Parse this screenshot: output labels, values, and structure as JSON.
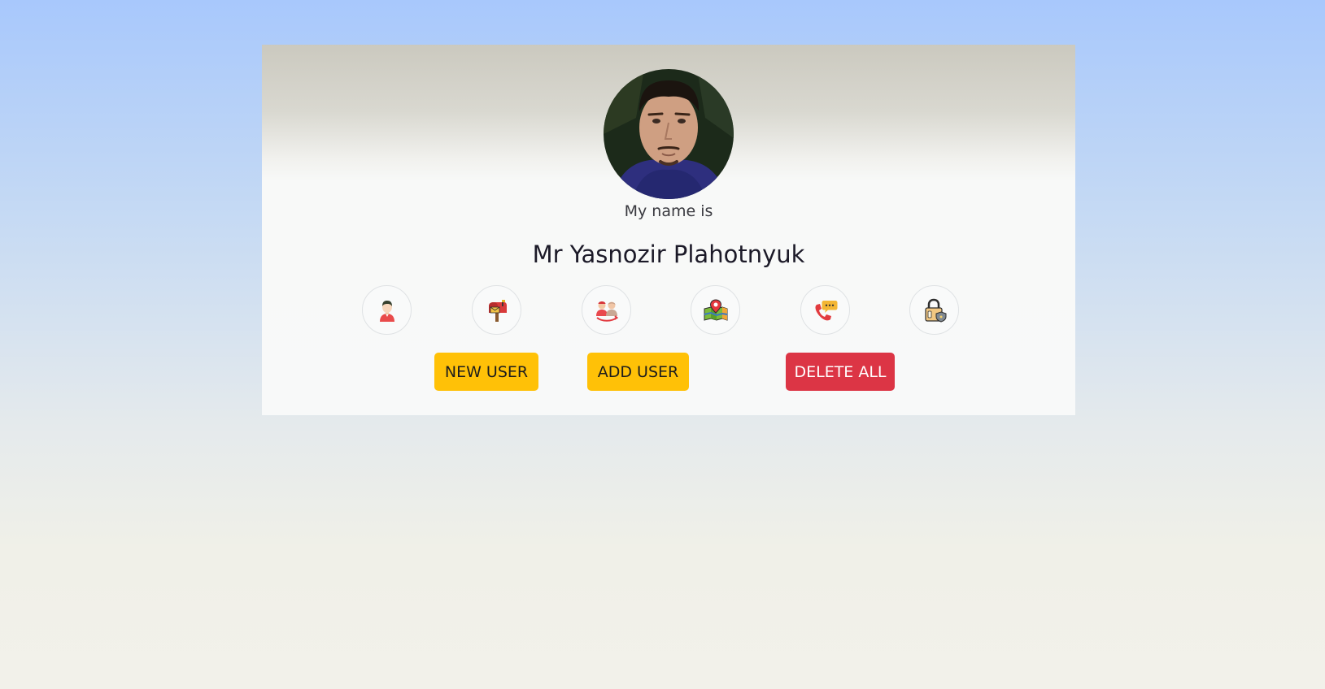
{
  "profile": {
    "intro_text": "My name is",
    "full_name": "Mr Yasnozir Plahotnyuk",
    "avatar_alt": "User avatar"
  },
  "icons": [
    {
      "name": "user-icon"
    },
    {
      "name": "mailbox-icon"
    },
    {
      "name": "users-exchange-icon"
    },
    {
      "name": "map-location-icon"
    },
    {
      "name": "phone-chat-icon"
    },
    {
      "name": "padlock-icon"
    }
  ],
  "actions": {
    "new_user_label": "NEW USER",
    "add_user_label": "ADD USER",
    "delete_all_label": "DELETE ALL"
  },
  "colors": {
    "warning": "#ffc107",
    "danger": "#dc3545"
  }
}
